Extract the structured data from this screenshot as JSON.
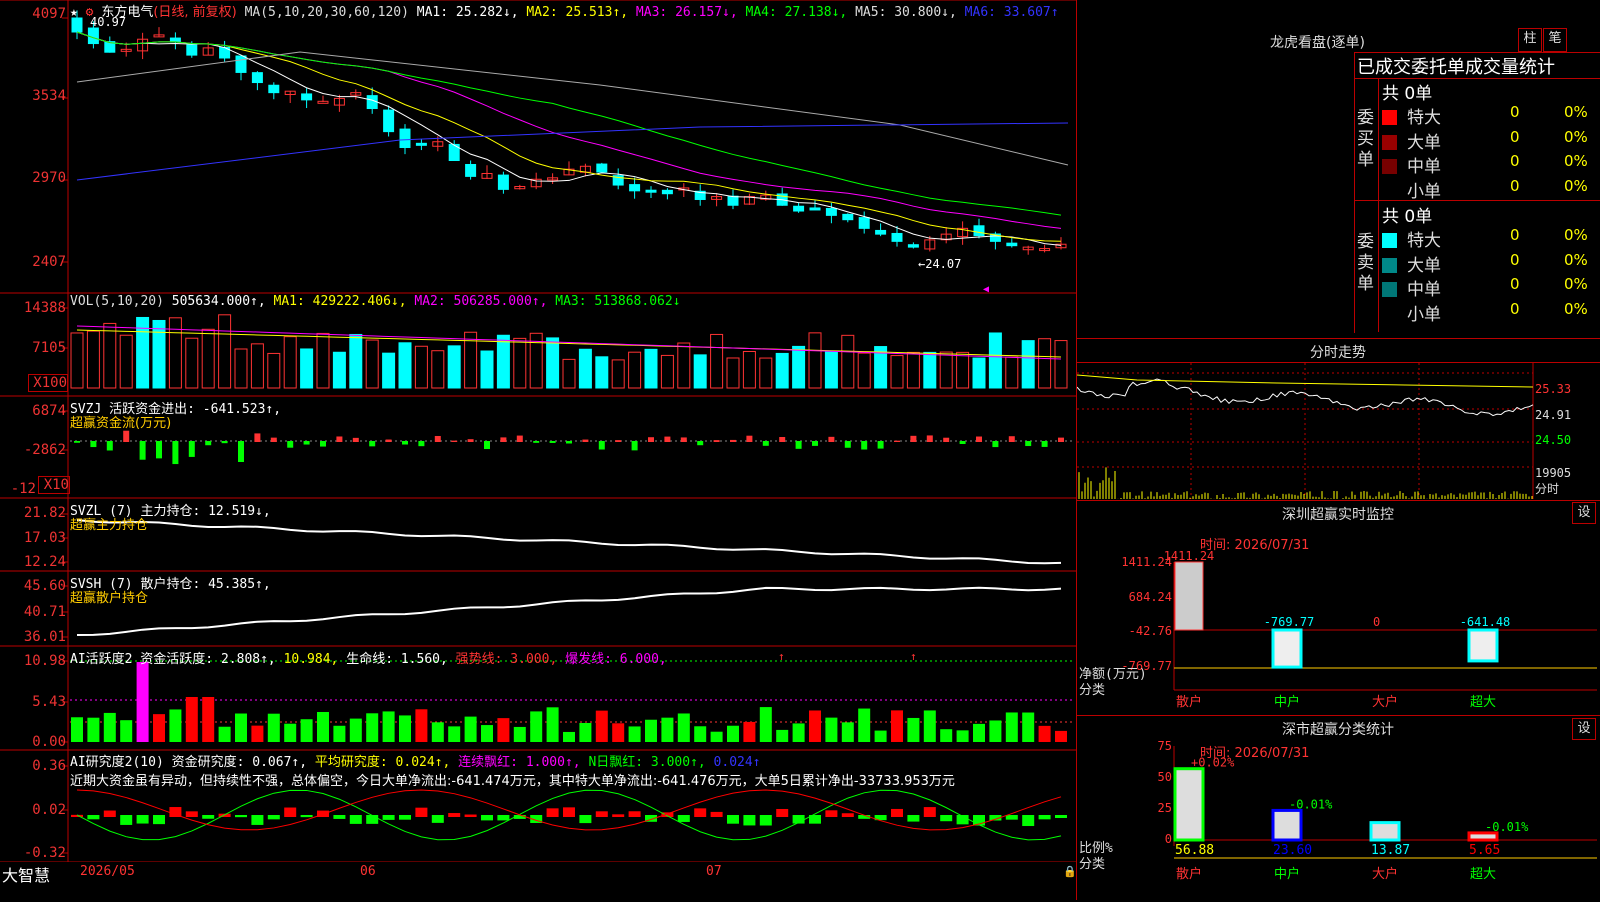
{
  "header": {
    "stock_name": "东方电气",
    "mode": "(日线, 前复权)",
    "ma_legend": [
      {
        "label": "MA(5,10,20,30,60,120)",
        "color": "#ddd"
      },
      {
        "label": "MA1: 25.282↓,",
        "color": "#fff"
      },
      {
        "label": "MA2: 25.513↑,",
        "color": "#ff0"
      },
      {
        "label": "MA3: 26.157↓,",
        "color": "#f0f"
      },
      {
        "label": "MA4: 27.138↓,",
        "color": "#0f0"
      },
      {
        "label": "MA5: 30.800↓,",
        "color": "#ddd"
      },
      {
        "label": "MA6: 33.607↑",
        "color": "#33f"
      }
    ],
    "high_marker": "40.97",
    "low_marker": "←24.07"
  },
  "price_axis": [
    "4097",
    "3534",
    "2970",
    "2407"
  ],
  "volume": {
    "legend": [
      {
        "label": "VOL(5,10,20)",
        "color": "#ddd"
      },
      {
        "label": "505634.000↑,",
        "color": "#fff"
      },
      {
        "label": "MA1: 429222.406↓,",
        "color": "#ff0"
      },
      {
        "label": "MA2: 506285.000↑,",
        "color": "#f0f"
      },
      {
        "label": "MA3: 513868.062↓",
        "color": "#0f0"
      }
    ],
    "axis": [
      "14388",
      "7105",
      "X100"
    ]
  },
  "svzj": {
    "legend": [
      {
        "label": "SVZJ  活跃资金进出: -641.523↑,",
        "color": "#fff"
      }
    ],
    "sub": "超赢资金流(万元)",
    "axis": [
      "6874",
      "-2862",
      "-12",
      "X10"
    ]
  },
  "svzl": {
    "legend": [
      {
        "label": "SVZL (7) 主力持仓: 12.519↓,",
        "color": "#fff"
      }
    ],
    "sub": "超赢主力持仓",
    "axis": [
      "21.82",
      "17.03",
      "12.24"
    ]
  },
  "svsh": {
    "legend": [
      {
        "label": "SVSH (7) 散户持仓: 45.385↑,",
        "color": "#fff"
      }
    ],
    "sub": "超赢散户持仓",
    "axis": [
      "45.60",
      "40.71",
      "36.01"
    ]
  },
  "ai_active": {
    "legend": [
      {
        "label": "AI活跃度2 资金活跃度: 2.808↑,",
        "color": "#fff"
      },
      {
        "label": "10.984,",
        "color": "#ff0"
      },
      {
        "label": "生命线: 1.560,",
        "color": "#fff"
      },
      {
        "label": "强势线: 3.000,",
        "color": "#f33"
      },
      {
        "label": "爆发线: 6.000,",
        "color": "#f0f"
      }
    ],
    "axis": [
      "10.98",
      "5.43",
      "0.00"
    ]
  },
  "ai_research": {
    "legend": [
      {
        "label": "AI研究度2(10) 资金研究度: 0.067↑,",
        "color": "#fff"
      },
      {
        "label": "平均研究度: 0.024↑,",
        "color": "#ff0"
      },
      {
        "label": "连续飘红: 1.000↑,",
        "color": "#f0f"
      },
      {
        "label": "N日飘红: 3.000↑,",
        "color": "#0f0"
      },
      {
        "label": "0.024↑",
        "color": "#33f"
      }
    ],
    "comment": "近期大资金虽有异动，但持续性不强，总体偏空，今日大单净流出:-641.474万元，其中特大单净流出:-641.476万元，大单5日累计净出-33733.953万元",
    "axis": [
      "0.36",
      "0.02",
      "-0.32"
    ]
  },
  "date_axis": [
    "2026/05",
    "06",
    "07"
  ],
  "app_name": "大智慧",
  "right": {
    "dragon_title": "龙虎看盘(逐单)",
    "btn_bar": "柱",
    "btn_pen": "笔",
    "stat_title": "已成交委托单成交量统计",
    "buy_label": "委买单",
    "sell_label": "委卖单",
    "buy_total": "共 0单",
    "sell_total": "共 0单",
    "buy_rows": [
      {
        "name": "特大",
        "count": "0",
        "pct": "0%",
        "color": "#f00"
      },
      {
        "name": "大单",
        "count": "0",
        "pct": "0%",
        "color": "#900"
      },
      {
        "name": "中单",
        "count": "0",
        "pct": "0%",
        "color": "#700"
      },
      {
        "name": "小单",
        "count": "0",
        "pct": "0%",
        "color": ""
      }
    ],
    "sell_rows": [
      {
        "name": "特大",
        "count": "0",
        "pct": "0%",
        "color": "#0ff"
      },
      {
        "name": "大单",
        "count": "0",
        "pct": "0%",
        "color": "#088"
      },
      {
        "name": "中单",
        "count": "0",
        "pct": "0%",
        "color": "#077"
      },
      {
        "name": "小单",
        "count": "0",
        "pct": "0%",
        "color": ""
      }
    ],
    "intraday_title": "分时走势",
    "intraday_axis": [
      "25.33",
      "24.91",
      "24.50",
      "19905",
      "分时"
    ],
    "monitor_title": "深圳超赢实时监控",
    "btn_set": "设",
    "monitor_time": "时间: 2026/07/31",
    "monitor_axis": [
      "1411.24",
      "684.24",
      "-42.76",
      "-769.77"
    ],
    "monitor_ylabel": "净额(万元)",
    "monitor_xlabel": "分类",
    "monitor_cats": [
      "散户",
      "中户",
      "大户",
      "超大"
    ],
    "monitor_values": [
      "1411.24",
      "-769.77",
      "0",
      "-641.48"
    ],
    "class_title": "深市超赢分类统计",
    "class_time": "时间: 2026/07/31",
    "class_axis": [
      "75",
      "50",
      "25",
      "0"
    ],
    "class_ylabel": "比例%",
    "class_xlabel": "分类",
    "class_cats": [
      "散户",
      "中户",
      "大户",
      "超大"
    ],
    "class_values": [
      "56.88",
      "23.60",
      "13.87",
      "5.65"
    ],
    "class_changes": [
      "+0.02%",
      "-0.01%",
      "",
      "-0.01%"
    ]
  }
}
